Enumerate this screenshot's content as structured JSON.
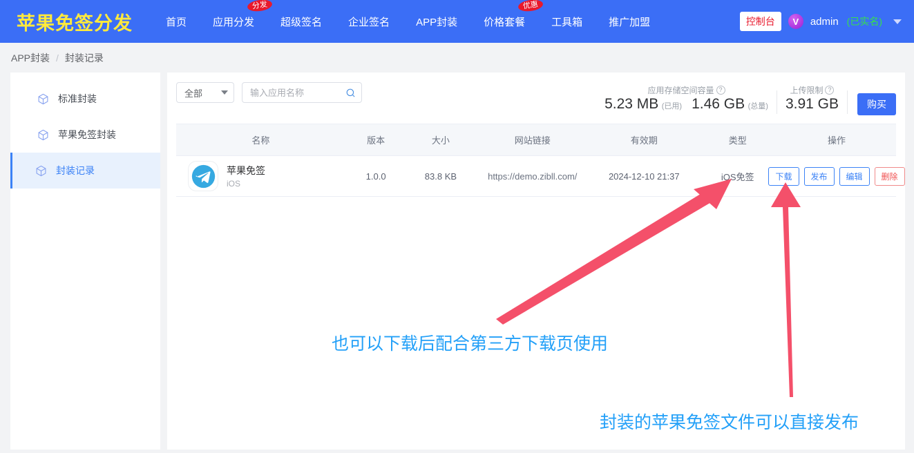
{
  "header": {
    "brand": "苹果免签分发",
    "nav": [
      {
        "label": "首页",
        "badge": null
      },
      {
        "label": "应用分发",
        "badge": "分发"
      },
      {
        "label": "超级签名",
        "badge": null
      },
      {
        "label": "企业签名",
        "badge": null
      },
      {
        "label": "APP封装",
        "badge": null
      },
      {
        "label": "价格套餐",
        "badge": "优惠"
      },
      {
        "label": "工具箱",
        "badge": null
      },
      {
        "label": "推广加盟",
        "badge": null
      }
    ],
    "console_label": "控制台",
    "avatar_letter": "V",
    "username": "admin",
    "verified": "(已实名)",
    "brand_color": "#ffe93d",
    "bar_color": "#3b6ef6",
    "badge_color": "#e8192c",
    "verified_color": "#37e04b"
  },
  "breadcrumb": {
    "parent": "APP封装",
    "separator": "/",
    "current": "封装记录"
  },
  "sidebar": {
    "items": [
      {
        "label": "标准封装",
        "icon": "cube-icon",
        "active": false
      },
      {
        "label": "苹果免签封装",
        "icon": "cube-icon",
        "active": false
      },
      {
        "label": "封装记录",
        "icon": "cube-icon",
        "active": true
      }
    ],
    "active_color": "#3b82f6"
  },
  "toolbar": {
    "filter_value": "全部",
    "search_placeholder": "输入应用名称",
    "search_value": "",
    "stats": [
      {
        "caption": "",
        "has_help": false,
        "value": "5.23 MB",
        "sub": "(已用)"
      },
      {
        "caption": "应用存储空间容量",
        "has_help": true,
        "value": "1.46 GB",
        "sub": "(总量)"
      },
      {
        "caption": "上传限制",
        "has_help": true,
        "value": "3.91 GB",
        "sub": ""
      }
    ],
    "storage_caption": "应用存储空间容量",
    "used_value": "5.23 MB",
    "used_sub": "(已用)",
    "total_value": "1.46 GB",
    "total_sub": "(总量)",
    "upload_caption": "上传限制",
    "upload_value": "3.91 GB",
    "buy_label": "购买",
    "buy_color": "#3b6ef6"
  },
  "table": {
    "columns": [
      "名称",
      "版本",
      "大小",
      "网站链接",
      "有效期",
      "类型",
      "操作"
    ],
    "rows": [
      {
        "icon": "telegram-paper-plane-icon",
        "name": "苹果免签",
        "platform": "iOS",
        "version": "1.0.0",
        "size": "83.8 KB",
        "link": "https://demo.zibll.com/",
        "expiry": "2024-12-10 21:37",
        "type": "iOS免签",
        "actions": [
          {
            "label": "下载",
            "style": "primary"
          },
          {
            "label": "发布",
            "style": "primary"
          },
          {
            "label": "编辑",
            "style": "primary"
          },
          {
            "label": "删除",
            "style": "danger"
          }
        ]
      }
    ]
  },
  "annotations": {
    "arrow_color": "#f4506a",
    "text_color": "#23a0f8",
    "note1": "也可以下载后配合第三方下载页使用",
    "note2": "封装的苹果免签文件可以直接发布"
  }
}
